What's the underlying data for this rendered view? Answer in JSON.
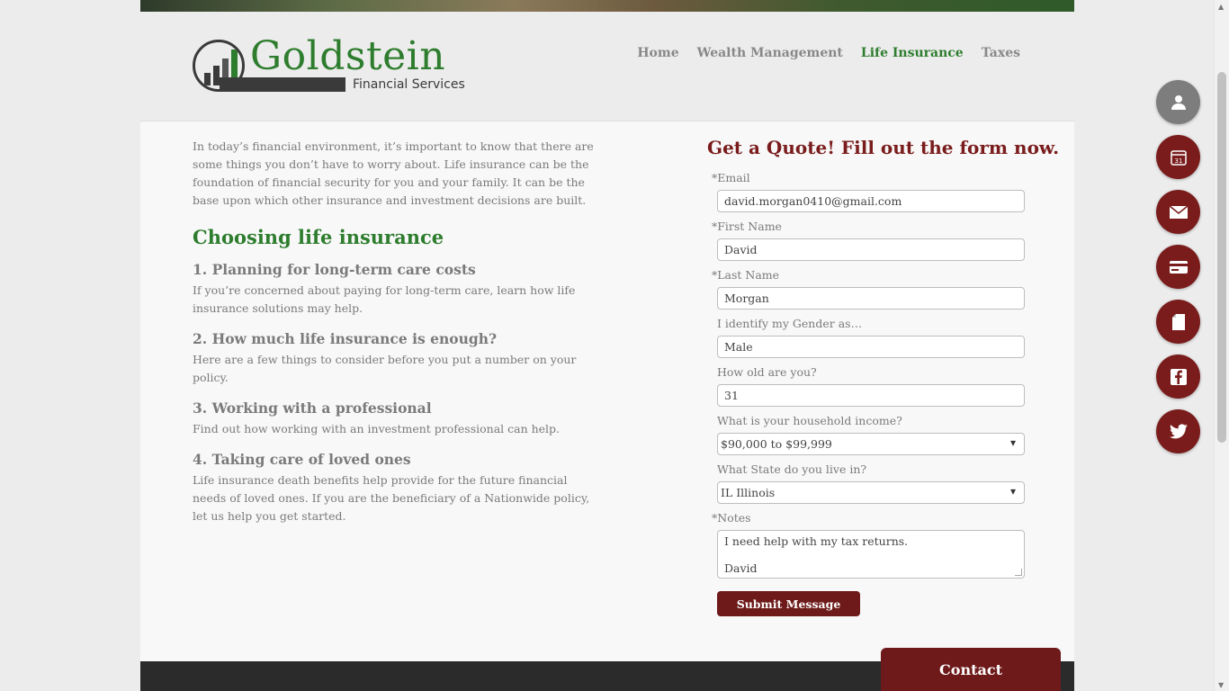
{
  "brand": {
    "name": "Goldstein",
    "subtitle": "Financial Services",
    "green": "#2e7d2e",
    "maroon": "#7a1c1c"
  },
  "nav": {
    "items": [
      {
        "label": "Home",
        "active": false
      },
      {
        "label": "Wealth Management",
        "active": false
      },
      {
        "label": "Life Insurance",
        "active": true
      },
      {
        "label": "Taxes",
        "active": false
      }
    ]
  },
  "article": {
    "intro": "In today’s financial environment, it’s important to know that there are some things you don’t have to worry about. Life insurance can be the foundation of financial security for you and your family. It can be the base upon which other insurance and investment decisions are built.",
    "heading": "Choosing life insurance",
    "sections": [
      {
        "title": "1. Planning for long-term care costs",
        "body": "If you’re concerned about paying for long-term care, learn how life insurance solutions may help."
      },
      {
        "title": "2. How much life insurance is enough?",
        "body": "Here are a few things to consider before you put a number on your policy."
      },
      {
        "title": "3. Working with a professional",
        "body": "Find out how working with an investment professional can help."
      },
      {
        "title": "4. Taking care of loved ones",
        "body": "Life insurance death benefits help provide for the future financial needs of loved ones. If you are the beneficiary of a Nationwide policy, let us help you get started."
      }
    ]
  },
  "form": {
    "title": "Get a Quote! Fill out the form now.",
    "email": {
      "label": "*Email",
      "value": "david.morgan0410@gmail.com"
    },
    "first_name": {
      "label": "*First Name",
      "value": "David"
    },
    "last_name": {
      "label": "*Last Name",
      "value": "Morgan"
    },
    "gender": {
      "label": "I identify my Gender as…",
      "value": "Male"
    },
    "age": {
      "label": "How old are you?",
      "value": "31"
    },
    "income": {
      "label": "What is your household income?",
      "value": "$90,000 to $99,999"
    },
    "state": {
      "label": "What State do you live in?",
      "value": "IL Illinois"
    },
    "notes": {
      "label": "*Notes",
      "line1": "I need help with my tax returns.",
      "line2": "David"
    },
    "submit_label": "Submit Message"
  },
  "contact_tab": {
    "label": "Contact"
  },
  "floating_buttons": [
    {
      "icon": "user-icon"
    },
    {
      "icon": "calendar-icon",
      "text": "31"
    },
    {
      "icon": "envelope-icon"
    },
    {
      "icon": "credit-card-icon"
    },
    {
      "icon": "document-icon"
    },
    {
      "icon": "facebook-icon"
    },
    {
      "icon": "twitter-icon"
    }
  ]
}
